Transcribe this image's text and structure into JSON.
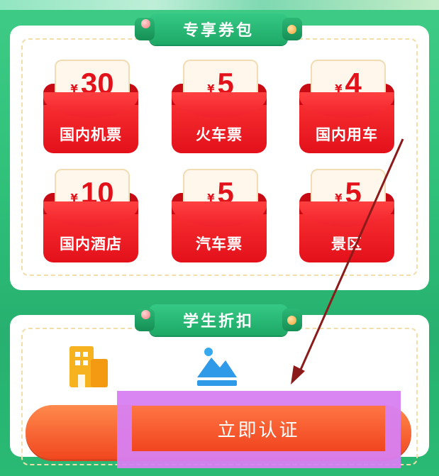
{
  "sections": {
    "coupons_title": "专享券包",
    "student_title": "学生折扣"
  },
  "coupons": [
    {
      "currency": "¥",
      "amount": "30",
      "label": "国内机票"
    },
    {
      "currency": "¥",
      "amount": "5",
      "label": "火车票"
    },
    {
      "currency": "¥",
      "amount": "4",
      "label": "国内用车"
    },
    {
      "currency": "¥",
      "amount": "10",
      "label": "国内酒店"
    },
    {
      "currency": "¥",
      "amount": "5",
      "label": "汽车票"
    },
    {
      "currency": "¥",
      "amount": "5",
      "label": "景区"
    }
  ],
  "student_icons": [
    "building-icon",
    "mountain-icon"
  ],
  "cta": {
    "label": "立即认证"
  },
  "colors": {
    "accent_green": "#2fc07a",
    "coupon_red": "#e3101a",
    "cta_orange": "#f1471f",
    "highlight_purple": "#d780f2",
    "arrow": "#8b1a1a"
  }
}
